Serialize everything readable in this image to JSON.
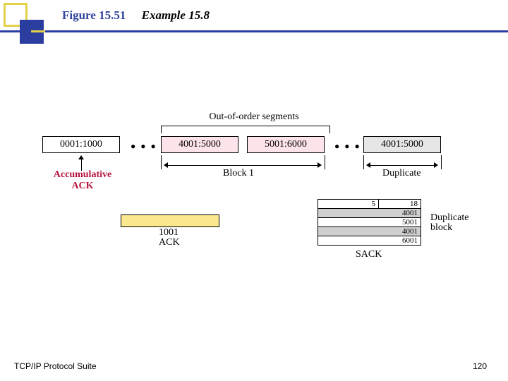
{
  "header": {
    "figure_label": "Figure 15.51",
    "example_label": "Example 15.8"
  },
  "diagram": {
    "ooo_label": "Out-of-order segments",
    "segments": {
      "s1": "0001:1000",
      "s2": "4001:5000",
      "s3": "5001:6000",
      "s4": "4001:5000"
    },
    "block1_label": "Block 1",
    "duplicate_label": "Duplicate",
    "accum_line1": "Accumulative",
    "accum_line2": "ACK",
    "ack_value": "1001",
    "ack_label": "ACK",
    "sack_label": "SACK",
    "right_label_l1": "Duplicate",
    "right_label_l2": "block",
    "sack_header": {
      "left": "5",
      "right": "18"
    },
    "sack_rows": [
      "4001",
      "5001",
      "4001",
      "6001"
    ]
  },
  "footer": {
    "left": "TCP/IP Protocol Suite",
    "page": "120"
  }
}
